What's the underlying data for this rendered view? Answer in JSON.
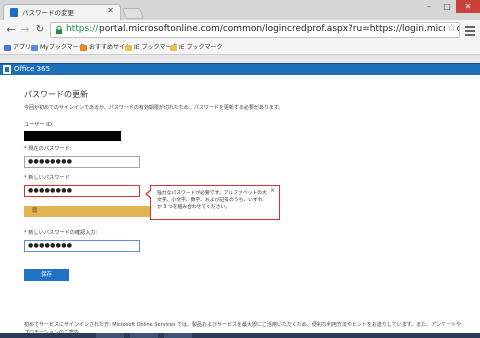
{
  "browser": {
    "tab_title": "パスワードの変更",
    "url_scheme": "https://",
    "url_rest": "portal.microsoftonline.com/common/logincredprof.aspx?ru=https://login.microsoftonline.com/login.",
    "bookmarks": [
      {
        "label": "アプリ",
        "color": "#4a7bd0"
      },
      {
        "label": "Myブックマーク",
        "color": "#5b8dd8"
      },
      {
        "label": "おすすめサイト",
        "color": "#e58a1e"
      },
      {
        "label": "IE ブックマーク",
        "color": "#e9c44a"
      },
      {
        "label": "IE ブックマーク",
        "color": "#e9c44a"
      }
    ]
  },
  "o365": {
    "name": "Office 365"
  },
  "page": {
    "heading": "パスワードの更新",
    "intro": "今回が初めてのサインインであるか、パスワードの有効期限が切れたため、パスワードを更新する必要があります。",
    "userid_label": "ユーザー ID:",
    "current_label": "現在のパスワード:",
    "current_value": "●●●●●●●●",
    "new_label": "新しいパスワード",
    "new_value": "●●●●●●●●",
    "strength": "弱",
    "tooltip": "強力なパスワードが必要です。アルファベットの大文字、小文字、数字、および記号のうち、いずれか 3 つを組み合わせてください。",
    "tooltip_close": "×",
    "confirm_label": "新しいパスワードの確認入力:",
    "confirm_value": "●●●●●●●●",
    "save": "保存",
    "footer": "初めてサービスにサインインされた方: Microsoft Online Services では、製品およびサービスを最大限にご活用いただくため、便利な利用方法やヒントをお送りしています。また、アンケートやプロモーションのご案内"
  },
  "colors": {
    "accent": "#2072c5",
    "error": "#d23434",
    "strength": "#e2b253",
    "o365": "#1d6fb8"
  }
}
